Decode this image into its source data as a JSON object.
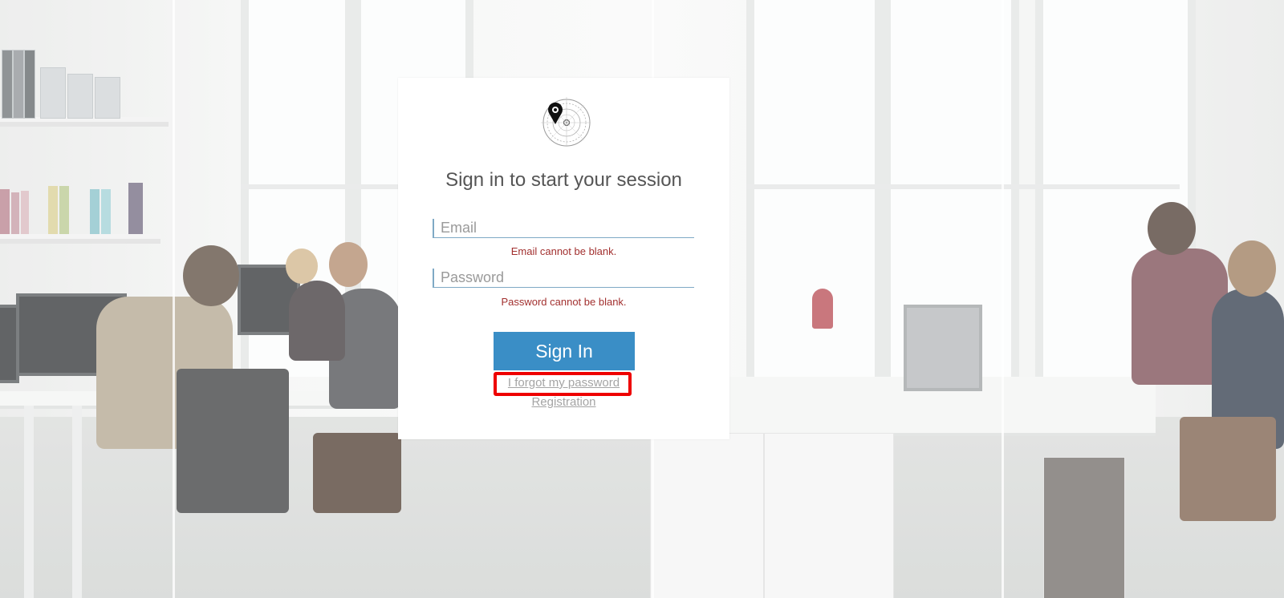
{
  "login": {
    "title": "Sign in to start your session",
    "email_placeholder": "Email",
    "email_error": "Email cannot be blank.",
    "password_placeholder": "Password",
    "password_error": "Password cannot be blank.",
    "sign_in_label": "Sign In",
    "forgot_password_label": "I forgot my password",
    "registration_label": "Registration"
  },
  "colors": {
    "accent": "#3a8ec6",
    "error": "#a2302f",
    "link": "#a4a4a4",
    "highlight": "#ee0000"
  },
  "icons": {
    "logo": "compass-location-pin-logo"
  }
}
